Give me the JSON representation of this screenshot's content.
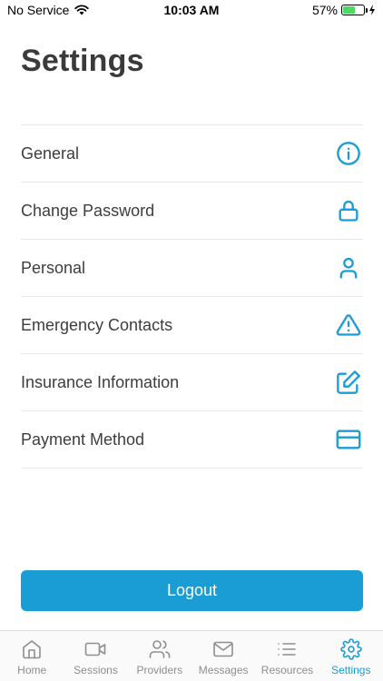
{
  "status_bar": {
    "carrier": "No Service",
    "time": "10:03 AM",
    "battery": "57%",
    "battery_level": 0.57
  },
  "page": {
    "title": "Settings"
  },
  "settings": {
    "items": [
      {
        "label": "General",
        "icon": "info-icon"
      },
      {
        "label": "Change Password",
        "icon": "lock-icon"
      },
      {
        "label": "Personal",
        "icon": "person-icon"
      },
      {
        "label": "Emergency Contacts",
        "icon": "warning-icon"
      },
      {
        "label": "Insurance Information",
        "icon": "edit-icon"
      },
      {
        "label": "Payment Method",
        "icon": "credit-card-icon"
      }
    ]
  },
  "logout": {
    "label": "Logout"
  },
  "tabs": [
    {
      "label": "Home",
      "icon": "home-icon"
    },
    {
      "label": "Sessions",
      "icon": "video-icon"
    },
    {
      "label": "Providers",
      "icon": "users-icon"
    },
    {
      "label": "Messages",
      "icon": "mail-icon"
    },
    {
      "label": "Resources",
      "icon": "list-icon"
    },
    {
      "label": "Settings",
      "icon": "gear-icon",
      "active": true
    }
  ],
  "colors": {
    "accent": "#1a9dd4",
    "inactive": "#8e8e8e",
    "battery": "#4cd964"
  }
}
